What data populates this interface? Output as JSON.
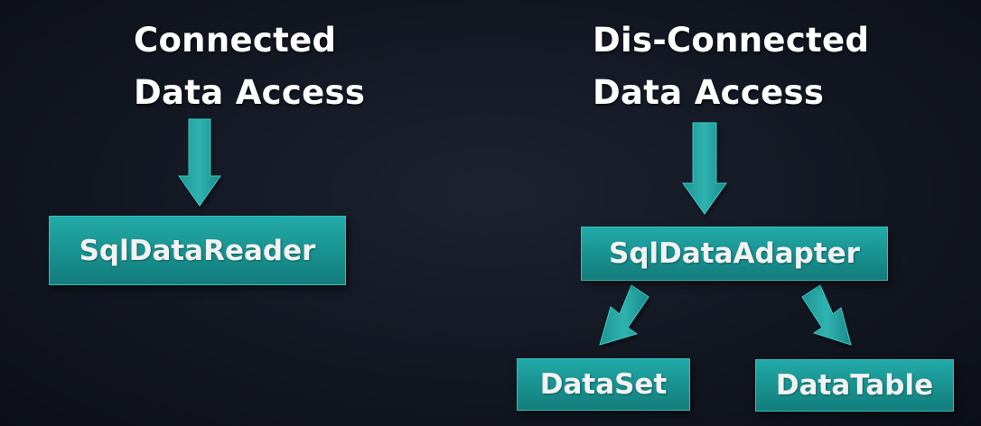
{
  "headings": {
    "connected": [
      "Connected",
      "Data Access"
    ],
    "disconnected": [
      "Dis-Connected",
      "Data Access"
    ]
  },
  "boxes": {
    "sqldatareader": "SqlDataReader",
    "sqldataadapter": "SqlDataAdapter",
    "dataset": "DataSet",
    "datatable": "DataTable"
  },
  "colors": {
    "background": "#131722",
    "box_fill": "#1a9896",
    "arrow_fill": "#2aa3a0",
    "text": "#ffffff"
  }
}
